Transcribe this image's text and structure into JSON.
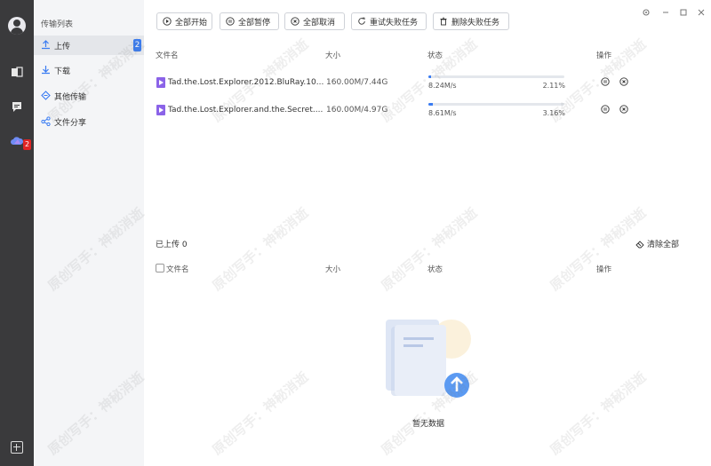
{
  "sidebar": {
    "title": "传输列表",
    "items": [
      {
        "label": "上传",
        "count": "2"
      },
      {
        "label": "下载"
      },
      {
        "label": "其他传输"
      },
      {
        "label": "文件分享"
      }
    ]
  },
  "rail": {
    "badge": "2"
  },
  "toolbar": {
    "start_all": "全部开始",
    "pause_all": "全部暂停",
    "cancel_all": "全部取消",
    "retry_failed": "重试失败任务",
    "delete_failed": "删除失败任务"
  },
  "columns": {
    "name": "文件名",
    "size": "大小",
    "status": "状态",
    "ops": "操作"
  },
  "uploading": [
    {
      "name": "Tad.the.Lost.Explorer.2012.BluRay.10...",
      "size": "160.00M/7.44G",
      "speed": "8.24M/s",
      "percent": "2.11%",
      "progress": 0.0211
    },
    {
      "name": "Tad.the.Lost.Explorer.and.the.Secret....",
      "size": "160.00M/4.97G",
      "speed": "8.61M/s",
      "percent": "3.16%",
      "progress": 0.0316
    }
  ],
  "uploaded": {
    "title": "已上传 0",
    "clear_all": "清除全部",
    "empty_text": "暂无数据"
  },
  "watermark": "原创写手：神秘消逝",
  "colors": {
    "accent": "#3a7cf2",
    "rail": "#3a3a3c",
    "badge": "#e02424",
    "file_icon": "#8b63e8"
  },
  "icons": [
    "user-avatar-icon",
    "office-icon",
    "chat-icon",
    "cloud-icon",
    "add-icon",
    "upload-icon",
    "download-icon",
    "transfer-icon",
    "share-icon",
    "play-icon",
    "pause-icon",
    "cancel-icon",
    "refresh-icon",
    "trash-icon",
    "eraser-icon"
  ]
}
